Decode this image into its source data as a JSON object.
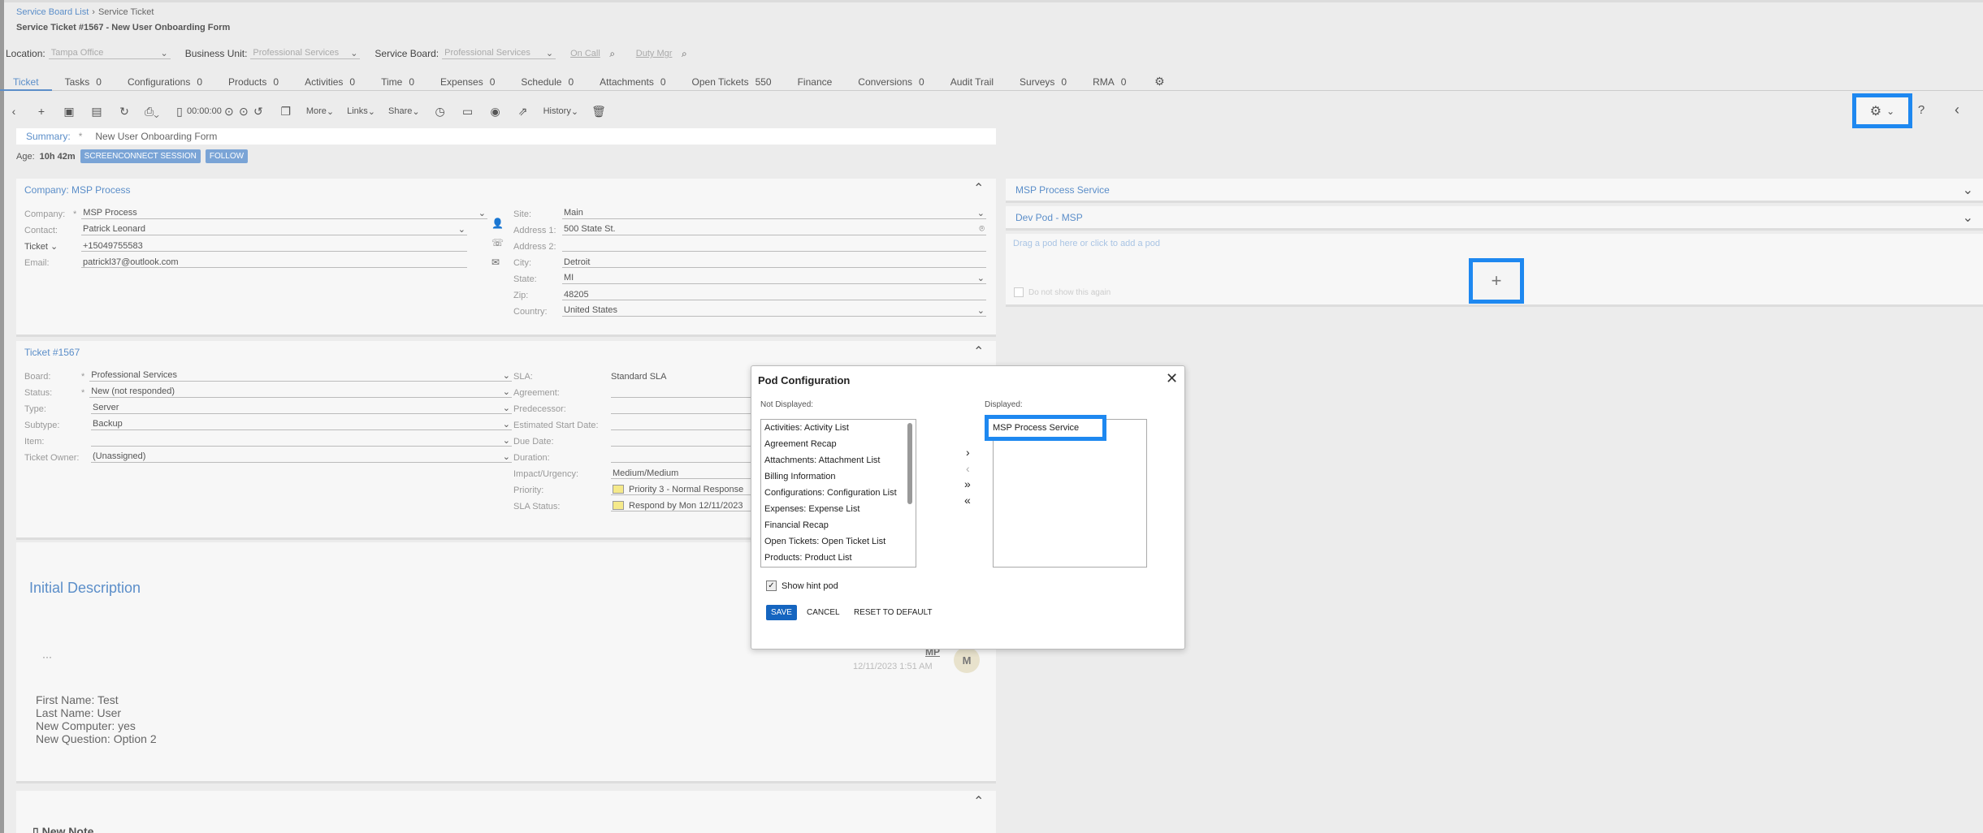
{
  "breadcrumb": {
    "root": "Service Board List",
    "current": "Service Ticket"
  },
  "page_title": "Service Ticket #1567 - New User Onboarding Form",
  "filters": {
    "location_label": "Location:",
    "location_value": "Tampa Office",
    "business_unit_label": "Business Unit:",
    "business_unit_value": "Professional Services",
    "service_board_label": "Service Board:",
    "service_board_value": "Professional Services",
    "on_call": "On Call",
    "duty_mgr": "Duty Mgr"
  },
  "tabs": [
    {
      "label": "Ticket",
      "count": ""
    },
    {
      "label": "Tasks",
      "count": "0"
    },
    {
      "label": "Configurations",
      "count": "0"
    },
    {
      "label": "Products",
      "count": "0"
    },
    {
      "label": "Activities",
      "count": "0"
    },
    {
      "label": "Time",
      "count": "0"
    },
    {
      "label": "Expenses",
      "count": "0"
    },
    {
      "label": "Schedule",
      "count": "0"
    },
    {
      "label": "Attachments",
      "count": "0"
    },
    {
      "label": "Open Tickets",
      "count": "550"
    },
    {
      "label": "Finance",
      "count": ""
    },
    {
      "label": "Conversions",
      "count": "0"
    },
    {
      "label": "Audit Trail",
      "count": ""
    },
    {
      "label": "Surveys",
      "count": "0"
    },
    {
      "label": "RMA",
      "count": "0"
    }
  ],
  "toolbar": {
    "timer": "00:00:00",
    "more": "More",
    "links": "Links",
    "share": "Share",
    "history": "History"
  },
  "summary": {
    "label": "Summary:",
    "req": "*",
    "value": "New User Onboarding Form"
  },
  "age": {
    "label": "Age:",
    "value": "10h 42m",
    "screenconnect": "SCREENCONNECT SESSION",
    "follow": "FOLLOW"
  },
  "company": {
    "header": "Company: MSP Process",
    "company_label": "Company:",
    "company_value": "MSP Process",
    "contact_label": "Contact:",
    "contact_value": "Patrick Leonard",
    "phone_type": "Ticket",
    "phone_value": "+15049755583",
    "email_label": "Email:",
    "email_value": "patrickl37@outlook.com",
    "site_label": "Site:",
    "site_value": "Main",
    "address1_label": "Address 1:",
    "address1_value": "500 State St.",
    "address2_label": "Address 2:",
    "address2_value": "",
    "city_label": "City:",
    "city_value": "Detroit",
    "state_label": "State:",
    "state_value": "MI",
    "zip_label": "Zip:",
    "zip_value": "48205",
    "country_label": "Country:",
    "country_value": "United States"
  },
  "ticket": {
    "header": "Ticket #1567",
    "board_label": "Board:",
    "board_value": "Professional Services",
    "status_label": "Status:",
    "status_value": "New (not responded)",
    "type_label": "Type:",
    "type_value": "Server",
    "subtype_label": "Subtype:",
    "subtype_value": "Backup",
    "item_label": "Item:",
    "item_value": "",
    "owner_label": "Ticket Owner:",
    "owner_value": "(Unassigned)",
    "sla_label": "SLA:",
    "sla_value": "Standard SLA",
    "agreement_label": "Agreement:",
    "predecessor_label": "Predecessor:",
    "est_start_label": "Estimated Start Date:",
    "due_label": "Due Date:",
    "duration_label": "Duration:",
    "impact_label": "Impact/Urgency:",
    "impact_value": "Medium/Medium",
    "priority_label": "Priority:",
    "priority_value": "Priority 3 - Normal Response",
    "sla_status_label": "SLA Status:",
    "sla_status_value": "Respond by Mon 12/11/2023"
  },
  "description": {
    "header": "Initial Description",
    "author": "MP",
    "timestamp": "12/11/2023 1:51 AM",
    "avatar": "M",
    "lines": [
      "First Name: Test",
      "Last Name: User",
      "New Computer: yes",
      "New Question: Option 2"
    ]
  },
  "new_note": "New Note",
  "pods": {
    "msp_process_service": "MSP Process Service",
    "dev_pod": "Dev Pod - MSP",
    "drag_hint": "Drag a pod here or click to add a pod",
    "dont_show": "Do not show this again"
  },
  "modal": {
    "title": "Pod Configuration",
    "not_displayed_label": "Not Displayed:",
    "displayed_label": "Displayed:",
    "not_displayed": [
      "Activities: Activity List",
      "Agreement Recap",
      "Attachments: Attachment List",
      "Billing Information",
      "Configurations: Configuration List",
      "Expenses: Expense List",
      "Financial Recap",
      "Open Tickets: Open Ticket List",
      "Products: Product List"
    ],
    "displayed": [
      "MSP Process Service"
    ],
    "show_hint": "Show hint pod",
    "save": "SAVE",
    "cancel": "CANCEL",
    "reset": "RESET TO DEFAULT"
  },
  "colors": {
    "accent": "#5b8ec9",
    "highlight": "#1e88f0",
    "save": "#1565c0"
  }
}
